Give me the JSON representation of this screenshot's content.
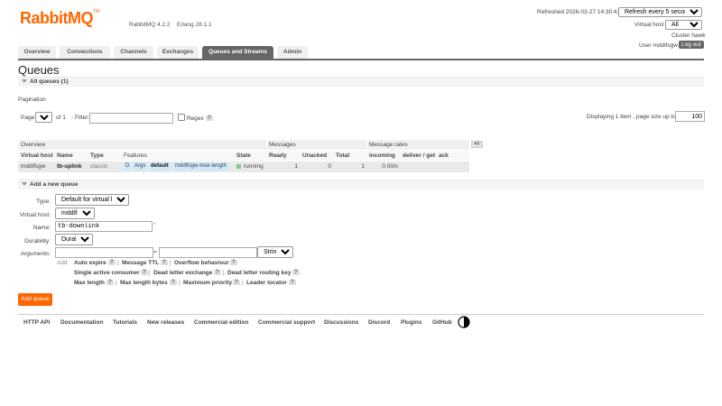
{
  "header": {
    "logo_text": "RabbitMQ",
    "logo_tm": "TM",
    "version": "RabbitMQ 4.2.2",
    "erlang": "Erlang 28.1.1",
    "refreshed": "Refreshed 2026-03-27 14:30:41",
    "refresh_option": "Refresh every 5 seconds",
    "vhost_label": "Virtual host",
    "vhost_value": "All",
    "cluster": "Cluster hawk",
    "user": "User mddifsgw",
    "logout": "Log out"
  },
  "nav": {
    "tabs": [
      "Overview",
      "Connections",
      "Channels",
      "Exchanges",
      "Queues and Streams",
      "Admin"
    ],
    "active": "Queues and Streams"
  },
  "page": {
    "title": "Queues",
    "all_queues": "All queues (1)"
  },
  "pagination": {
    "label": "Pagination",
    "page_label": "Page",
    "page_value": "1",
    "of_text": "of 1",
    "filter_label": "- Filter:",
    "filter_value": "",
    "regex_label": "Regex",
    "help": "?",
    "displaying": "Displaying 1 item , page size up to:",
    "page_size": "100"
  },
  "table": {
    "group_headers": [
      "Overview",
      "Messages",
      "Message rates",
      "+/-"
    ],
    "columns": [
      "Virtual host",
      "Name",
      "Type",
      "Features",
      "State",
      "Ready",
      "Unacked",
      "Total",
      "incoming",
      "deliver / get",
      "ack"
    ],
    "rows": [
      {
        "vhost": "mddifsgw",
        "name": "tb-uplink",
        "type": "classic",
        "features": [
          "D",
          "Args",
          "default",
          "mddifsgw-max-length"
        ],
        "state": "running",
        "state_color": "#8c8",
        "ready": "1",
        "unacked": "0",
        "total": "1",
        "incoming": "0.00/s",
        "deliver_get": "",
        "ack": ""
      }
    ]
  },
  "add_queue": {
    "section_label": "Add a new queue",
    "type_label": "Type:",
    "type_value": "Default for virtual host",
    "vhost_label": "Virtual host:",
    "vhost_value": "mddifsgw",
    "name_label": "Name:",
    "name_value": "tb-downlink",
    "required_mark": "*",
    "durability_label": "Durability:",
    "durability_value": "Durable",
    "arguments_label": "Arguments:",
    "equals": "=",
    "arg_type": "String",
    "add_text": "Add",
    "arg_rows": [
      [
        "Auto expire",
        "Message TTL",
        "Overflow behaviour"
      ],
      [
        "Single active consumer",
        "Dead letter exchange",
        "Dead letter routing key"
      ],
      [
        "Max length",
        "Max length bytes",
        "Maximum priority",
        "Leader locator"
      ]
    ],
    "separator": "|",
    "button": "Add queue"
  },
  "footer": {
    "links": [
      "HTTP API",
      "Documentation",
      "Tutorials",
      "New releases",
      "Commercial edition",
      "Commercial support",
      "Discussions",
      "Discord",
      "Plugins",
      "GitHub"
    ]
  },
  "colors": {
    "brand": "#ff6600",
    "nav_active": "#666666",
    "tag_bg": "#cfe9f7",
    "running": "#88cc88"
  }
}
